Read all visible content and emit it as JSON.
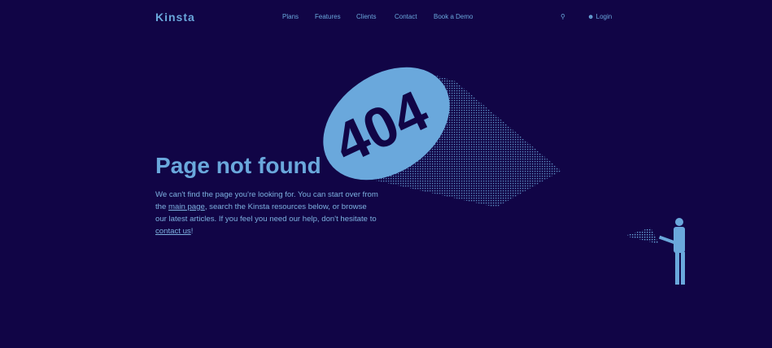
{
  "header": {
    "logo": "Kinsta",
    "nav": [
      "Plans",
      "Features",
      "Clients",
      "Contact",
      "Book a Demo"
    ],
    "login": "Login",
    "icons": [
      "search-icon",
      "user-icon"
    ]
  },
  "main": {
    "title": "Page not found",
    "text1": "We can't find the page you're looking for. You can start over from the ",
    "link1": "main page",
    "text2": ", search the Kinsta resources below, or browse our latest articles. If you feel you need our help, don't hesitate to ",
    "link2": "contact us",
    "text3": "!"
  },
  "illustration": {
    "number": "404"
  },
  "colors": {
    "background": "#110546",
    "accent": "#6aa8dc"
  }
}
